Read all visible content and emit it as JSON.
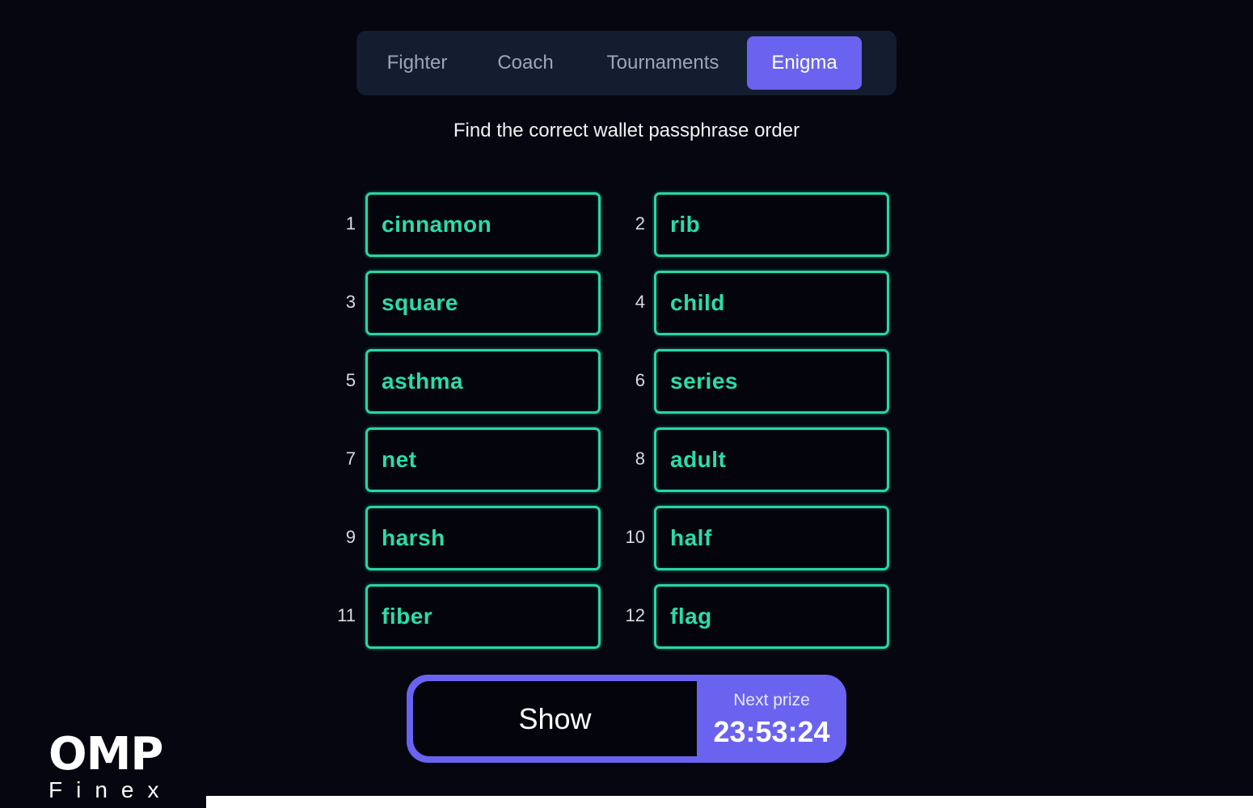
{
  "tabs": [
    {
      "label": "Fighter",
      "active": false
    },
    {
      "label": "Coach",
      "active": false
    },
    {
      "label": "Tournaments",
      "active": false
    },
    {
      "label": "Enigma",
      "active": true
    }
  ],
  "subtitle": "Find the correct wallet passphrase order",
  "words": [
    {
      "num": "1",
      "word": "cinnamon"
    },
    {
      "num": "2",
      "word": "rib"
    },
    {
      "num": "3",
      "word": "square"
    },
    {
      "num": "4",
      "word": "child"
    },
    {
      "num": "5",
      "word": "asthma"
    },
    {
      "num": "6",
      "word": "series"
    },
    {
      "num": "7",
      "word": "net"
    },
    {
      "num": "8",
      "word": "adult"
    },
    {
      "num": "9",
      "word": "harsh"
    },
    {
      "num": "10",
      "word": "half"
    },
    {
      "num": "11",
      "word": "fiber"
    },
    {
      "num": "12",
      "word": "flag"
    }
  ],
  "show_label": "Show",
  "prize": {
    "label": "Next prize",
    "timer": "23:53:24"
  },
  "logo": {
    "mark": "OMP",
    "name": "Finex"
  },
  "colors": {
    "background": "#05060f",
    "accent": "#6a63f0",
    "word_green": "#27d6a6",
    "tabbar": "#141c2f"
  }
}
